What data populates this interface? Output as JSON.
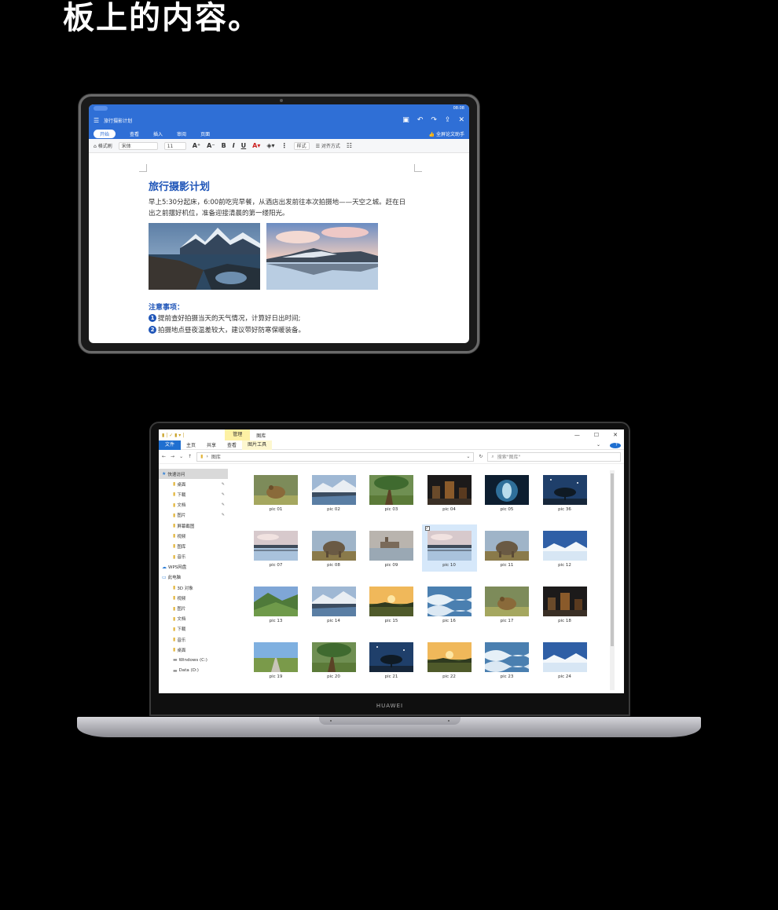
{
  "headline": "板上的内容。",
  "tablet": {
    "status": {
      "time": "08:08"
    },
    "titlebar": {
      "doc_name": "旅行摄影计划"
    },
    "tabs": [
      "开始",
      "查看",
      "插入",
      "审阅",
      "页面"
    ],
    "assistant": "全屏论文助手",
    "toolbar": {
      "format_painter": "格式刷",
      "font": "宋体",
      "size": "11",
      "style": "样式",
      "align": "对齐方式"
    },
    "doc": {
      "title": "旅行摄影计划",
      "para": "早上5:30分起床，6:00前吃完早餐，从酒店出发前往本次拍摄地——天空之城。赶在日出之前摆好机位，准备迎接清晨的第一缕阳光。",
      "notice": "注意事项：",
      "items": [
        {
          "num": "1",
          "text": "提前查好拍摄当天的天气情况，计算好日出时间;"
        },
        {
          "num": "2",
          "text": "拍摄地点昼夜温差较大，建议带好防寒保暖装备。"
        }
      ]
    }
  },
  "laptop": {
    "brand": "HUAWEI",
    "explorer": {
      "manage_tab": "管理",
      "window_title": "图库",
      "ribbon": [
        "文件",
        "主页",
        "共享",
        "查看",
        "图片工具"
      ],
      "address": "图库",
      "search_placeholder": "搜索\"图库\"",
      "nav": [
        {
          "label": "快速访问",
          "level": 0,
          "icon": "star-icon",
          "selected": true
        },
        {
          "label": "桌面",
          "level": 1,
          "icon": "folder-icon",
          "pin": true
        },
        {
          "label": "下载",
          "level": 1,
          "icon": "folder-icon",
          "pin": true
        },
        {
          "label": "文档",
          "level": 1,
          "icon": "folder-icon",
          "pin": true
        },
        {
          "label": "图片",
          "level": 1,
          "icon": "folder-icon",
          "pin": true
        },
        {
          "label": "屏幕截图",
          "level": 1,
          "icon": "folder-icon"
        },
        {
          "label": "视频",
          "level": 1,
          "icon": "folder-icon"
        },
        {
          "label": "图库",
          "level": 1,
          "icon": "folder-icon"
        },
        {
          "label": "音乐",
          "level": 1,
          "icon": "folder-icon"
        },
        {
          "label": "WPS网盘",
          "level": 0,
          "icon": "cloud-icon"
        },
        {
          "label": "此电脑",
          "level": 0,
          "icon": "computer-icon"
        },
        {
          "label": "3D 对象",
          "level": 1,
          "icon": "folder-icon"
        },
        {
          "label": "视频",
          "level": 1,
          "icon": "folder-icon"
        },
        {
          "label": "图片",
          "level": 1,
          "icon": "folder-icon"
        },
        {
          "label": "文档",
          "level": 1,
          "icon": "folder-icon"
        },
        {
          "label": "下载",
          "level": 1,
          "icon": "folder-icon"
        },
        {
          "label": "音乐",
          "level": 1,
          "icon": "folder-icon"
        },
        {
          "label": "桌面",
          "level": 1,
          "icon": "folder-icon"
        },
        {
          "label": "Windows (C:)",
          "level": 1,
          "icon": "drive-icon"
        },
        {
          "label": "Data (D:)",
          "level": 1,
          "icon": "drive-icon"
        }
      ],
      "files": [
        {
          "name": "pic 01",
          "theme": "frog"
        },
        {
          "name": "pic 02",
          "theme": "mountain-lake"
        },
        {
          "name": "pic 03",
          "theme": "tree"
        },
        {
          "name": "pic 04",
          "theme": "night-city"
        },
        {
          "name": "pic 05",
          "theme": "cave"
        },
        {
          "name": "pic 36",
          "theme": "night-tree"
        },
        {
          "name": "pic 07",
          "theme": "island-sky"
        },
        {
          "name": "pic 08",
          "theme": "elephant"
        },
        {
          "name": "pic 09",
          "theme": "castle"
        },
        {
          "name": "pic 10",
          "theme": "island-sky",
          "selected": true
        },
        {
          "name": "pic 11",
          "theme": "elephant"
        },
        {
          "name": "pic 12",
          "theme": "snow-blue"
        },
        {
          "name": "pic 13",
          "theme": "valley"
        },
        {
          "name": "pic 14",
          "theme": "mountain-lake"
        },
        {
          "name": "pic 15",
          "theme": "sunset"
        },
        {
          "name": "pic 16",
          "theme": "waves"
        },
        {
          "name": "pic 17",
          "theme": "frog"
        },
        {
          "name": "pic 18",
          "theme": "night-city"
        },
        {
          "name": "pic 19",
          "theme": "road"
        },
        {
          "name": "pic 20",
          "theme": "tree"
        },
        {
          "name": "pic 21",
          "theme": "night-tree"
        },
        {
          "name": "pic 22",
          "theme": "sunset"
        },
        {
          "name": "pic 23",
          "theme": "waves"
        },
        {
          "name": "pic 24",
          "theme": "snow-blue"
        }
      ]
    }
  }
}
